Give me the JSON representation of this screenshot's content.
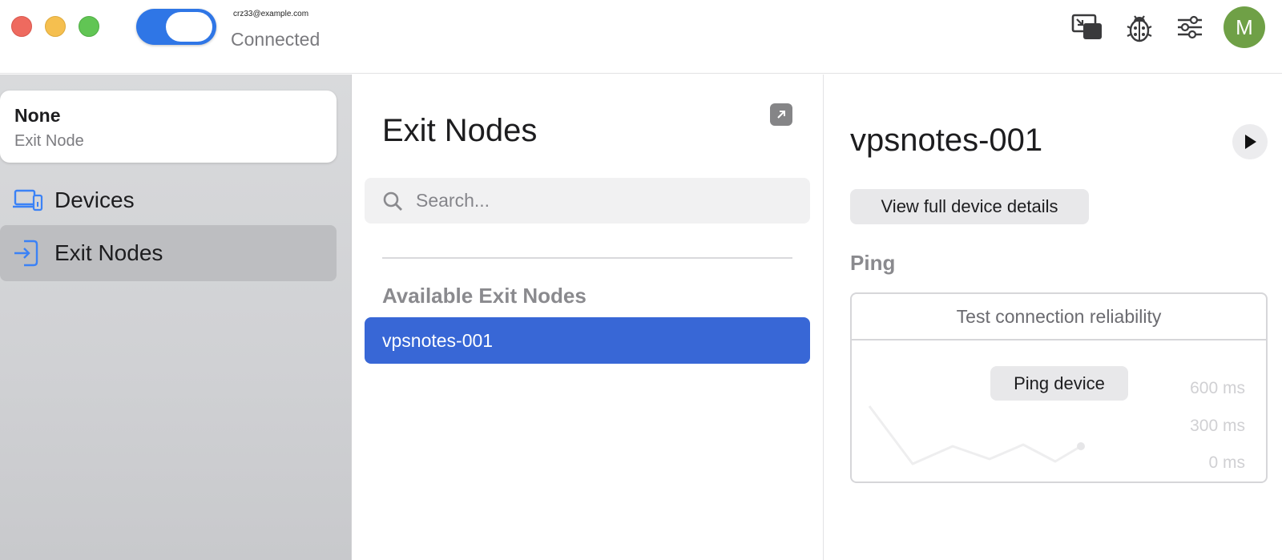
{
  "titlebar": {
    "account_email": "crz33@example.com",
    "status": "Connected",
    "avatar_initial": "M",
    "icons": [
      "screen-share-icon",
      "bug-icon",
      "sliders-icon"
    ]
  },
  "sidebar": {
    "exit_node_card": {
      "title": "None",
      "subtitle": "Exit Node"
    },
    "items": [
      {
        "label": "Devices",
        "icon": "devices-icon",
        "selected": false
      },
      {
        "label": "Exit Nodes",
        "icon": "exit-nodes-icon",
        "selected": true
      }
    ]
  },
  "middle": {
    "title": "Exit Nodes",
    "search": {
      "placeholder": "Search...",
      "value": ""
    },
    "section_heading": "Available Exit Nodes",
    "nodes": [
      {
        "name": "vpsnotes-001",
        "selected": true
      }
    ]
  },
  "detail": {
    "device_name": "vpsnotes-001",
    "view_details_label": "View full device details",
    "ping_heading": "Ping",
    "ping_box_title": "Test connection reliability",
    "ping_button_label": "Ping device",
    "ticks": [
      "600 ms",
      "300 ms",
      "0 ms"
    ]
  },
  "colors": {
    "accent": "#3867d6",
    "toggle_on": "#2f76e6",
    "avatar": "#6fa046"
  }
}
